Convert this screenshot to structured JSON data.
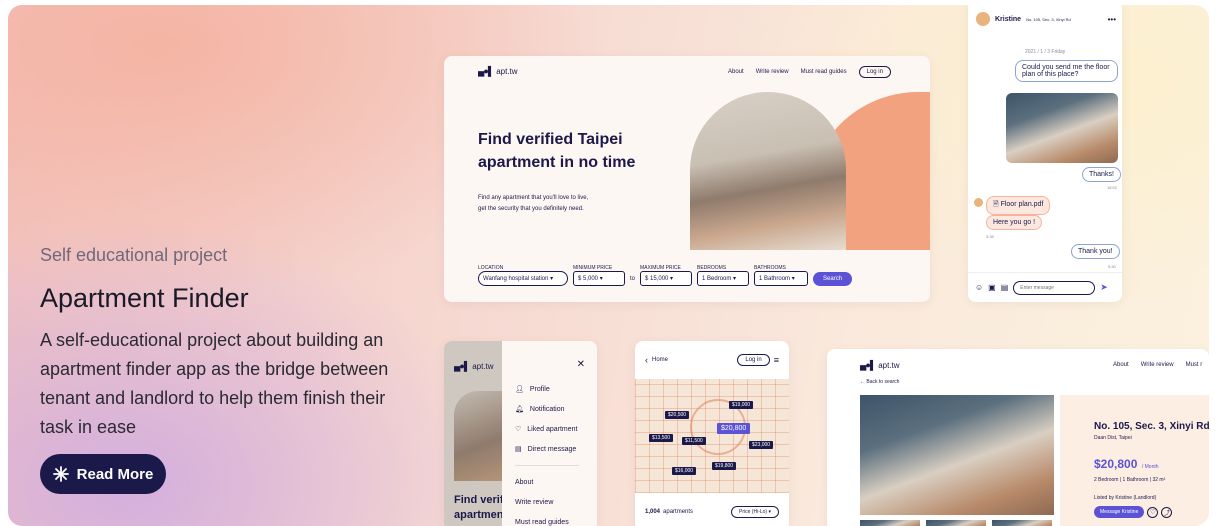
{
  "hero": {
    "kicker": "Self educational project",
    "title": "Apartment Finder",
    "description": "A self-educational project about building an apartment finder app as the bridge between tenant and landlord to help them finish their task in ease",
    "cta": "Read More",
    "cta_icon": "asterisk-icon"
  },
  "landing": {
    "logo": "apt.tw",
    "nav": [
      "About",
      "Write review",
      "Must read guides"
    ],
    "login": "Log in",
    "headline_1": "Find verified Taipei",
    "headline_2": "apartment in no time",
    "sub_1": "Find any apartment that you'll love to live,",
    "sub_2": "get the security that you definitely need.",
    "filters": {
      "location_label": "LOCATION",
      "location": "Wanfang hospital station",
      "min_label": "MINIMUM PRICE",
      "min": "$ 5,000",
      "to": "to",
      "max_label": "MAXIMUM PRICE",
      "max": "$ 15,000",
      "bed_label": "BEDROOMS",
      "bed": "1 Bedroom",
      "bath_label": "BATHROOMS",
      "bath": "1 Bathroom",
      "search": "Search"
    }
  },
  "chat": {
    "name": "Kristine",
    "address": "No. 105, Sec. 3, Xinyi Rd",
    "date": "2021 / 1 / 3 Friday",
    "msg1": "Could you send me the floor plan of this place?",
    "thanks": "Thanks!",
    "time1": "18:52",
    "file": "Floor plan.pdf",
    "here": "Here you go !",
    "time2": "3:38",
    "thankyou": "Thank you!",
    "time3": "9:30",
    "placeholder": "Enter message"
  },
  "menu": {
    "logo": "apt.tw",
    "items": [
      "Profile",
      "Notification",
      "Liked apartment",
      "Direct message"
    ],
    "links": [
      "About",
      "Write review",
      "Must read guides"
    ],
    "peek": "Find verifi",
    "peek2": "apartmen"
  },
  "mapview": {
    "back": "Home",
    "login": "Log in",
    "count": "1,004",
    "count_label": "apartments",
    "sort": "Price (Hi-Lo)",
    "prices": [
      "$20,500",
      "$19,000",
      "$13,500",
      "$11,500",
      "$20,800",
      "$23,000",
      "$16,000",
      "$19,800"
    ]
  },
  "detail": {
    "logo": "apt.tw",
    "nav": [
      "About",
      "Write review",
      "Must r"
    ],
    "back": "Back to search",
    "title": "No. 105, Sec. 3, Xinyi Rd",
    "district": "Daan Dist, Taipei",
    "price": "$20,800",
    "per": "/ Month",
    "specs": "2 Bedroom | 1 Bathroom | 32 m²",
    "listed": "Listed by Kristine (Landlord)",
    "message": "Message Kristine"
  }
}
